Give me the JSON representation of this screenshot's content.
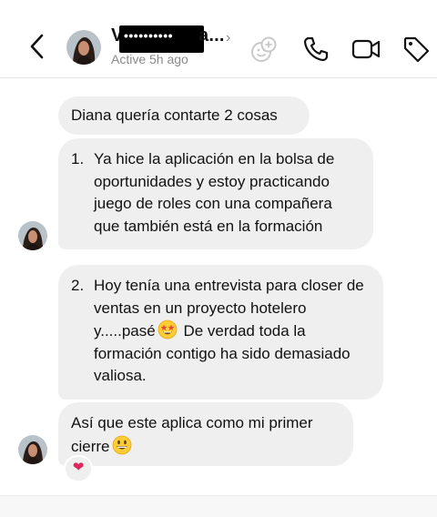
{
  "header": {
    "name_visible": "V",
    "name_redacted": "••••••••••",
    "name_tail": "a...",
    "status": "Active 5h ago",
    "icons": [
      "back-chevron-icon",
      "add-person-icon",
      "phone-icon",
      "video-camera-icon",
      "tag-icon"
    ]
  },
  "messages": [
    {
      "text": "Diana quería contarte 2 cosas"
    },
    {
      "number": "1.",
      "text": "Ya hice la aplicación en la bolsa de oportunidades y estoy practicando juego de roles con una compañera que también está en la formación"
    },
    {
      "number": "2.",
      "text_before_emoji": "Hoy tenía una entrevista para closer de ventas en un proyecto hotelero y.....pasé",
      "emoji": "star-struck-emoji",
      "text_after_emoji": " De verdad toda la formación contigo ha sido demasiado valiosa."
    },
    {
      "text": "Así que este aplica como mi primer cierre",
      "emoji": "grinning-emoji",
      "reaction": "❤"
    }
  ],
  "colors": {
    "bubble": "#efefef",
    "muted": "#8a8a8a",
    "heart": "#e0245e"
  }
}
